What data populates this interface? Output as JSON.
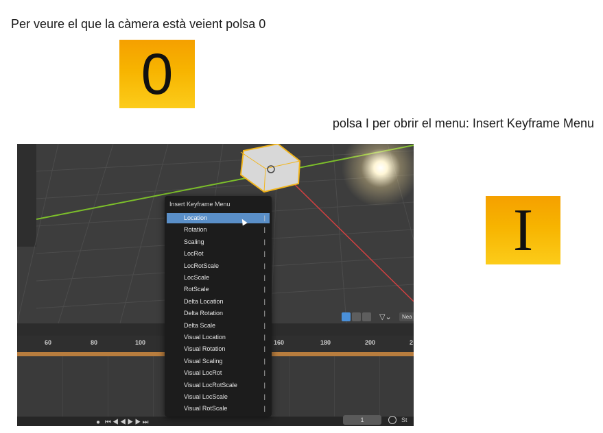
{
  "instructions": {
    "camera": "Per veure el que la càmera està veient polsa 0",
    "insert": "polsa I per obrir el menu: Insert Keyframe Menu"
  },
  "keys": {
    "zero": "0",
    "i": "I"
  },
  "screenshot": {
    "timeline_ticks": [
      "60",
      "80",
      "100",
      "160",
      "180",
      "200",
      "2"
    ],
    "frame_value": "1",
    "st_label": "St",
    "filter_field": "Nea",
    "menu": {
      "title": "Insert Keyframe Menu",
      "items": [
        "Location",
        "Rotation",
        "Scaling",
        "LocRot",
        "LocRotScale",
        "LocScale",
        "RotScale",
        "Delta Location",
        "Delta Rotation",
        "Delta Scale",
        "Visual Location",
        "Visual Rotation",
        "Visual Scaling",
        "Visual LocRot",
        "Visual LocRotScale",
        "Visual LocScale",
        "Visual RotScale"
      ],
      "selected_index": 0
    }
  }
}
